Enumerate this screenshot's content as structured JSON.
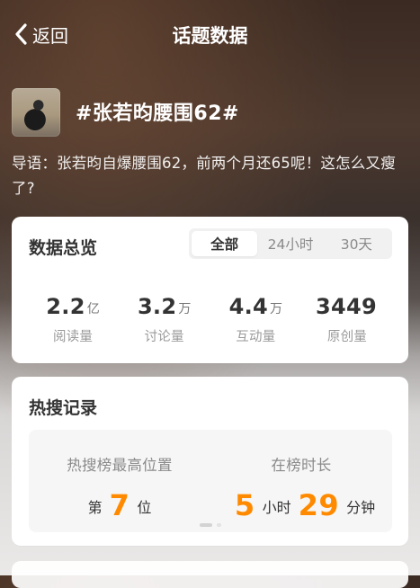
{
  "header": {
    "back_label": "返回",
    "title": "话题数据"
  },
  "topic": {
    "name": "#张若昀腰围62#"
  },
  "intro": {
    "prefix": "导语：",
    "text": "张若昀自爆腰围62，前两个月还65呢！这怎么又瘦了?"
  },
  "overview": {
    "title": "数据总览",
    "tabs": [
      {
        "label": "全部",
        "active": true
      },
      {
        "label": "24小时",
        "active": false
      },
      {
        "label": "30天",
        "active": false
      }
    ],
    "stats": [
      {
        "value": "2.2",
        "unit": "亿",
        "label": "阅读量"
      },
      {
        "value": "3.2",
        "unit": "万",
        "label": "讨论量"
      },
      {
        "value": "4.4",
        "unit": "万",
        "label": "互动量"
      },
      {
        "value": "3449",
        "unit": "",
        "label": "原创量"
      }
    ]
  },
  "hot_search": {
    "title": "热搜记录",
    "highest": {
      "label": "热搜榜最高位置",
      "prefix": "第",
      "value": "7",
      "suffix": "位"
    },
    "duration": {
      "label": "在榜时长",
      "hours": "5",
      "hours_unit": "小时",
      "minutes": "29",
      "minutes_unit": "分钟"
    }
  },
  "colors": {
    "accent_orange": "#ff8a00",
    "text_dark": "#333333",
    "text_muted": "#8a8a8a",
    "card_bg": "#ffffff"
  },
  "icons": {
    "back": "chevron-left-icon"
  }
}
